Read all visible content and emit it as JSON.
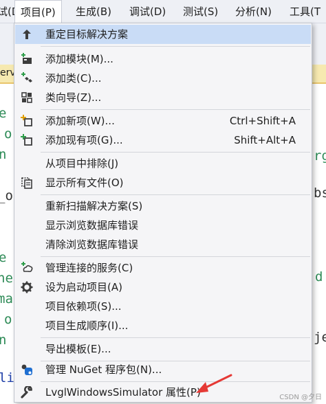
{
  "menubar": {
    "items": [
      {
        "label": "试(D)"
      },
      {
        "label": "项目(P)"
      },
      {
        "label": "生成(B)"
      },
      {
        "label": "调试(D)"
      },
      {
        "label": "测试(S)"
      },
      {
        "label": "分析(N)"
      },
      {
        "label": "工具(T"
      }
    ]
  },
  "background": {
    "tab_text": "erve",
    "code_left": [
      "e",
      "o",
      "n",
      "_o",
      "e",
      "ne",
      "ma",
      "o",
      "n",
      "li"
    ],
    "code_right": [
      "rg",
      "bs",
      "d",
      "je"
    ]
  },
  "menu": {
    "items": [
      {
        "label": "重定目标解决方案",
        "icon": "arrow-up-icon"
      },
      {
        "label": "添加模块(M)...",
        "icon": "add-module-icon"
      },
      {
        "label": "添加类(C)...",
        "icon": "add-class-icon"
      },
      {
        "label": "类向导(Z)...",
        "icon": "class-wizard-icon"
      },
      {
        "label": "添加新项(W)...",
        "icon": "add-new-item-icon",
        "shortcut": "Ctrl+Shift+A"
      },
      {
        "label": "添加现有项(G)...",
        "icon": "add-existing-item-icon",
        "shortcut": "Shift+Alt+A"
      },
      {
        "label": "从项目中排除(J)"
      },
      {
        "label": "显示所有文件(O)",
        "icon": "show-all-files-icon"
      },
      {
        "label": "重新扫描解决方案(S)"
      },
      {
        "label": "显示浏览数据库错误"
      },
      {
        "label": "清除浏览数据库错误"
      },
      {
        "label": "管理连接的服务(C)",
        "icon": "connected-services-icon"
      },
      {
        "label": "设为启动项目(A)",
        "icon": "gear-icon"
      },
      {
        "label": "项目依赖项(S)..."
      },
      {
        "label": "项目生成顺序(I)..."
      },
      {
        "label": "导出模板(E)..."
      },
      {
        "label": "管理 NuGet 程序包(N)...",
        "icon": "nuget-icon"
      },
      {
        "label": "LvglWindowsSimulator 属性(P)",
        "icon": "wrench-icon"
      }
    ]
  },
  "colors": {
    "highlight": "#c9dcf6",
    "arrow": "#e53935",
    "icon_dark": "#3c3c3c",
    "icon_green": "#2e9e4a",
    "icon_blue": "#1f6fd1"
  },
  "watermark": "CSDN @夕日"
}
